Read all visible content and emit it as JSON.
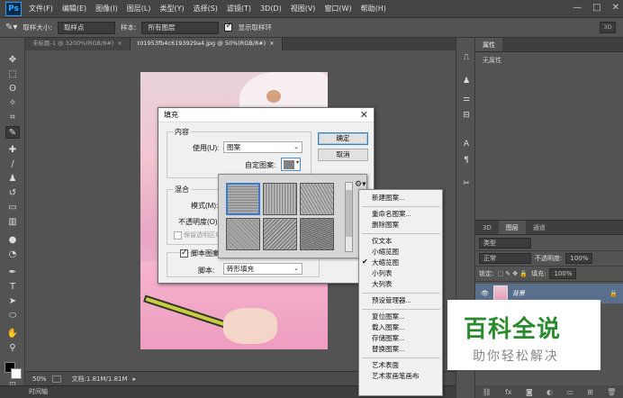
{
  "app": {
    "logo": "Ps"
  },
  "menubar": [
    "文件(F)",
    "编辑(E)",
    "图像(I)",
    "图层(L)",
    "类型(Y)",
    "选择(S)",
    "滤镜(T)",
    "3D(D)",
    "视图(V)",
    "窗口(W)",
    "帮助(H)"
  ],
  "window_controls": [
    "—",
    "□",
    "✕"
  ],
  "options_bar": {
    "sample_size_label": "取样大小:",
    "sample_size_value": "取样点",
    "sample_label": "样本:",
    "sample_value": "所有图层",
    "show_ring_label": "显示取样环",
    "show_ring_checked": true,
    "mode_3d": "3D"
  },
  "doc_tabs": [
    {
      "label": "未标题-1 @ 3200%(RGB/8#)",
      "active": false
    },
    {
      "label": "t01953fb4c6193929a4.jpg @ 50%(RGB/8#)",
      "active": true
    }
  ],
  "status": {
    "zoom": "50%",
    "doc": "文档:1.81M/1.81M"
  },
  "timeline_label": "时间轴",
  "panels": {
    "properties_tab": "属性",
    "properties_empty": "无属性",
    "layers_tabs": [
      "3D",
      "图层",
      "通道"
    ],
    "filter_kind": "类型",
    "blend_mode": "正常",
    "opacity_label": "不透明度:",
    "opacity_value": "100%",
    "lock_label": "锁定:",
    "fill_label": "填充:",
    "fill_value": "100%",
    "layer_name": "背景"
  },
  "fill_dialog": {
    "title": "填充",
    "content_group": "内容",
    "use_label": "使用(U):",
    "use_value": "图案",
    "custom_pattern_label": "自定图案:",
    "blend_group": "混合",
    "mode_label": "模式(M):",
    "opacity_label": "不透明度(O):",
    "preserve_label": "保留透明区域",
    "script_pattern_label": "脚本图案",
    "script_checked": true,
    "script_label": "脚本:",
    "script_value": "砖形填充",
    "ok": "确定",
    "cancel": "取消"
  },
  "pattern_menu": {
    "items": [
      {
        "label": "新建图案...",
        "checked": false
      },
      {
        "sep": true
      },
      {
        "label": "重命名图案...",
        "checked": false
      },
      {
        "label": "删除图案",
        "checked": false
      },
      {
        "sep": true
      },
      {
        "label": "仅文本",
        "checked": false
      },
      {
        "label": "小缩览图",
        "checked": false
      },
      {
        "label": "大缩览图",
        "checked": true
      },
      {
        "label": "小列表",
        "checked": false
      },
      {
        "label": "大列表",
        "checked": false
      },
      {
        "sep": true
      },
      {
        "label": "预设管理器...",
        "checked": false
      },
      {
        "sep": true
      },
      {
        "label": "复位图案...",
        "checked": false
      },
      {
        "label": "载入图案...",
        "checked": false
      },
      {
        "label": "存储图案...",
        "checked": false
      },
      {
        "label": "替换图案...",
        "checked": false
      },
      {
        "sep": true
      },
      {
        "label": "艺术表面",
        "checked": false
      },
      {
        "label": "艺术家画笔画布",
        "checked": false
      }
    ]
  },
  "watermark": {
    "title": "百科全说",
    "subtitle": "助你轻松解决"
  }
}
